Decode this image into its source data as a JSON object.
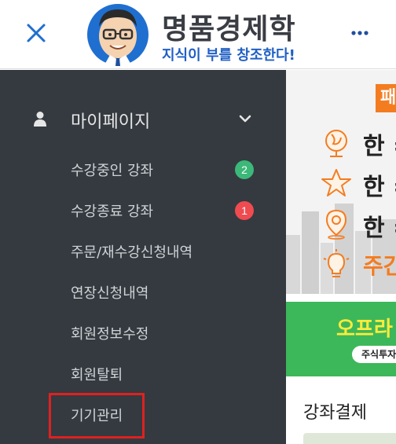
{
  "header": {
    "brand_title": "명품경제학",
    "brand_subtitle": "지식이 부를 창조한다!",
    "close_icon": "close-icon",
    "more_icon": "more-horizontal-icon"
  },
  "drawer": {
    "section_title": "마이페이지",
    "section_icon": "person-icon",
    "expand_icon": "chevron-down-icon",
    "items": [
      {
        "label": "수강중인 강좌",
        "badge": "2",
        "badge_color": "#3cb878"
      },
      {
        "label": "수강종료 강좌",
        "badge": "1",
        "badge_color": "#ef4b50"
      },
      {
        "label": "주문/재수강신청내역"
      },
      {
        "label": "연장신청내역"
      },
      {
        "label": "회원정보수정"
      },
      {
        "label": "회원탈퇴"
      },
      {
        "label": "기기관리"
      }
    ],
    "highlight_color": "#e02020"
  },
  "content": {
    "promo_tab": "패",
    "promo_rows": [
      {
        "icon": "globe-icon",
        "text": "한 ="
      },
      {
        "icon": "star-icon",
        "text": "한 ="
      },
      {
        "icon": "location-pin-icon",
        "text": "한 ="
      },
      {
        "icon": "lightbulb-icon",
        "text": "주간"
      }
    ],
    "green_banner_title": "오프라",
    "green_banner_pill": "주식투자",
    "section_title": "강좌결제"
  },
  "colors": {
    "drawer_bg": "#343a40",
    "accent_blue": "#1f5fc5",
    "orange": "#f47c20",
    "green": "#3cb85a"
  }
}
